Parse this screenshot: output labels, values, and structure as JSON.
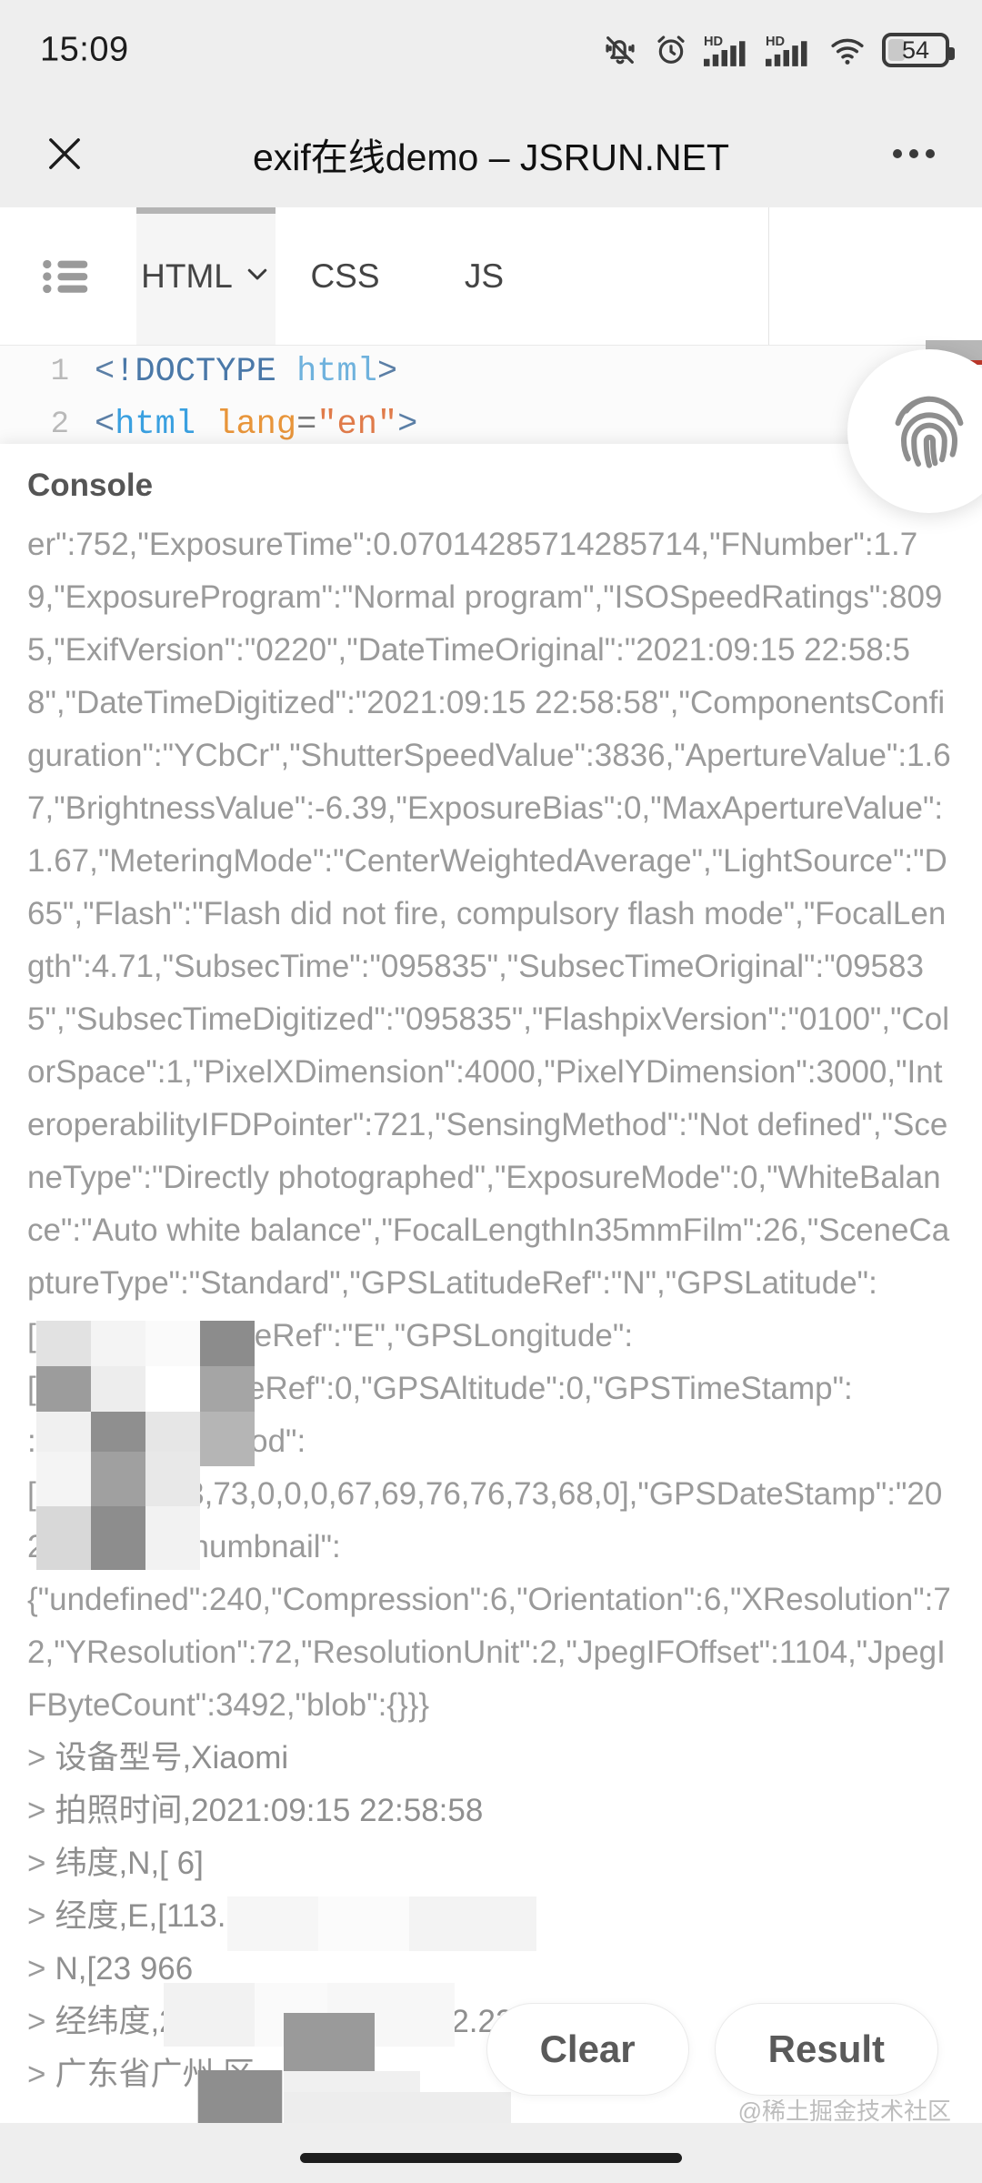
{
  "statusbar": {
    "time": "15:09",
    "battery_percent": "54",
    "icons": [
      "bell-muted-icon",
      "alarm-clock-icon",
      "hd-signal-icon",
      "hd-signal-icon",
      "wifi-icon",
      "battery-icon"
    ]
  },
  "appbar": {
    "close_label": "✕",
    "title": "exif在线demo – JSRUN.NET",
    "more_label": "···"
  },
  "tabs": {
    "list_icon": "list-icon",
    "items": [
      {
        "label": "HTML",
        "active": true,
        "has_chevron": true
      },
      {
        "label": "CSS",
        "active": false,
        "has_chevron": false
      },
      {
        "label": "JS",
        "active": false,
        "has_chevron": false
      }
    ]
  },
  "editor": {
    "lines": [
      {
        "number": "1",
        "text": "<!DOCTYPE html>"
      },
      {
        "number": "2",
        "text": "<html lang=\"en\">"
      }
    ],
    "line1": {
      "num": "1",
      "lt": "<",
      "doctype": "!DOCTYPE",
      "tagname": "html",
      "gt": ">"
    },
    "line2": {
      "num": "2",
      "lt": "<",
      "tagname": "html",
      "attr": "lang",
      "eq": "=",
      "str": "\"en\"",
      "gt": ">"
    }
  },
  "fab": {
    "icon": "fingerprint-icon"
  },
  "console": {
    "title": "Console",
    "json_text": "er\":752,\"ExposureTime\":0.07014285714285714,\"FNumber\":1.79,\"ExposureProgram\":\"Normal program\",\"ISOSpeedRatings\":8095,\"ExifVersion\":\"0220\",\"DateTimeOriginal\":\"2021:09:15 22:58:58\",\"DateTimeDigitized\":\"2021:09:15 22:58:58\",\"ComponentsConfiguration\":\"YCbCr\",\"ShutterSpeedValue\":3836,\"ApertureValue\":1.67,\"BrightnessValue\":-6.39,\"ExposureBias\":0,\"MaxApertureValue\":1.67,\"MeteringMode\":\"CenterWeightedAverage\",\"LightSource\":\"D65\",\"Flash\":\"Flash did not fire, compulsory flash mode\",\"FocalLength\":4.71,\"SubsecTime\":\"095835\",\"SubsecTimeOriginal\":\"095835\",\"SubsecTimeDigitized\":\"095835\",\"FlashpixVersion\":\"0100\",\"ColorSpace\":1,\"PixelXDimension\":4000,\"PixelYDimension\":3000,\"InteroperabilityIFDPointer\":721,\"SensingMethod\":\"Not defined\",\"SceneType\":\"Directly photographed\",\"ExposureMode\":0,\"WhiteBalance\":\"Auto white balance\",\"FocalLengthIn35mmFilm\":26,\"SceneCaptureType\":\"Standard\",\"GPSLatitudeRef\":\"N\",\"GPSLatitude\":",
    "json_text_2": "[                  ]\"GPSLongitudeRef\":\"E\",\"GPSLongitude\":",
    "json_text_3": "[1                 ],\"GPSAltitudeRef\":0,\"GPSAltitude\":0,\"GPSTimeStamp\":",
    "json_text_4": ":[              ocessingMethod\":",
    "json_text_5": "[65,83,67,73,73,0,0,0,67,69,76,76,73,68,0],\"GPSDateStamp\":\"2021:09:15\",\"thumbnail\":",
    "json_text_6": "{\"undefined\":240,\"Compression\":6,\"Orientation\":6,\"XResolution\":72,\"YResolution\":72,\"ResolutionUnit\":2,\"JpegIFOffset\":1104,\"JpegIFByteCount\":3492,\"blob\":{}}}",
    "log_lines": [
      {
        "caret": ">",
        "text": "设备型号,Xiaomi"
      },
      {
        "caret": ">",
        "text": "拍照时间,2021:09:15 22:58:58"
      },
      {
        "caret": ">",
        "text": "纬度,N,[                6]"
      },
      {
        "caret": ">",
        "text": "经度,E,[113.23          0"
      },
      {
        "caret": ">",
        "text": "N,[23                  966"
      },
      {
        "caret": ">",
        "text": "经纬度,23.        3499999999      3.3          2.22"
      },
      {
        "caret": ">",
        "text": "广东省广州           区"
      }
    ]
  },
  "actions": {
    "clear_label": "Clear",
    "result_label": "Result"
  },
  "watermark": "@稀土掘金技术社区"
}
